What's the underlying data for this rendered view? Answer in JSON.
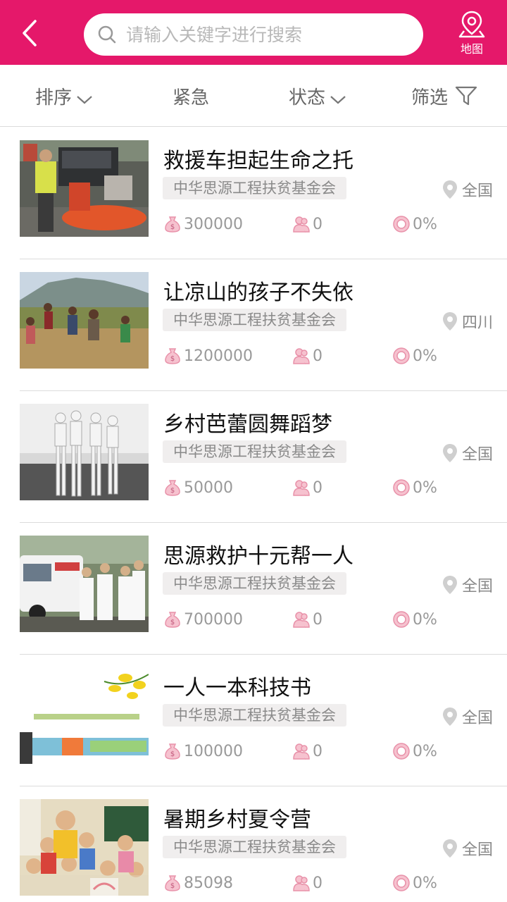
{
  "header": {
    "back_icon": "chevron-left-icon",
    "search_placeholder": "请输入关键字进行搜索",
    "map_label": "地图",
    "accent_color": "#e5186a"
  },
  "filters": {
    "sort_label": "排序",
    "urgent_label": "紧急",
    "status_label": "状态",
    "filter_label": "筛选"
  },
  "projects": [
    {
      "title": "救援车担起生命之托",
      "org": "中华思源工程扶贫基金会",
      "location": "全国",
      "amount": "300000",
      "donors": "0",
      "progress": "0%"
    },
    {
      "title": "让凉山的孩子不失依",
      "org": "中华思源工程扶贫基金会",
      "location": "四川",
      "amount": "1200000",
      "donors": "0",
      "progress": "0%"
    },
    {
      "title": "乡村芭蕾圆舞蹈梦",
      "org": "中华思源工程扶贫基金会",
      "location": "全国",
      "amount": "50000",
      "donors": "0",
      "progress": "0%"
    },
    {
      "title": "思源救护十元帮一人",
      "org": "中华思源工程扶贫基金会",
      "location": "全国",
      "amount": "700000",
      "donors": "0",
      "progress": "0%"
    },
    {
      "title": "一人一本科技书",
      "org": "中华思源工程扶贫基金会",
      "location": "全国",
      "amount": "100000",
      "donors": "0",
      "progress": "0%"
    },
    {
      "title": "暑期乡村夏令营",
      "org": "中华思源工程扶贫基金会",
      "location": "全国",
      "amount": "85098",
      "donors": "0",
      "progress": "0%"
    }
  ]
}
